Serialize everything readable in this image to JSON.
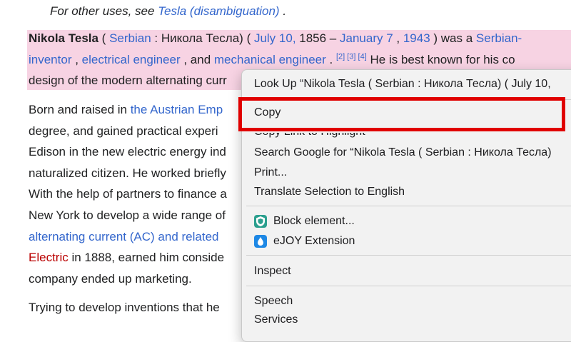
{
  "article": {
    "hatnote": {
      "prefix": "For other uses, see ",
      "link": "Tesla (disambiguation)",
      "suffix": " ."
    },
    "p1": {
      "line1": {
        "name": "Nikola Tesla",
        "t1": " ( ",
        "serbian": "Serbian",
        "t2": " : Никола Тесла) ( ",
        "date1": "July 10,",
        "t3": " 1856 – ",
        "date2": "January 7",
        "t4": " , ",
        "year2": "1943",
        "t5": " ) was a ",
        "serbian2": "Serbian-"
      },
      "line2": {
        "inventor": "inventor",
        "c1": " , ",
        "ee": "electrical engineer",
        "c2": " , and ",
        "me": "mechanical engineer",
        "c3": " . ",
        "refs": "[2] [3] [4]",
        "rest": " He is best known for his co"
      },
      "line3": "design of the modern alternating curr"
    },
    "p2": {
      "line1": {
        "text": "Born and raised in ",
        "link": "the Austrian Emp"
      },
      "line2": "degree, and gained practical experi",
      "line3": "Edison in the new electric energy ind",
      "line4": "naturalized citizen. He worked briefly",
      "line5": "With the help of partners to finance a",
      "line6": "New York to develop a wide range of",
      "line7": "alternating current (AC) and related",
      "line8": {
        "link": "Electric",
        "text": " in 1888, earned him conside"
      },
      "line9": "company ended up marketing."
    },
    "p3": {
      "line1": "Trying to develop inventions that he"
    }
  },
  "context_menu": {
    "lookup": "Look Up “Nikola Tesla ( Serbian : Никола Тесла) ( July 10,",
    "copy": "Copy",
    "copy_link": "Copy Link to Highlight",
    "search_google": "Search Google for “Nikola Tesla ( Serbian : Никола Тесла)",
    "print": "Print...",
    "translate": "Translate Selection to English",
    "block": "Block element...",
    "ejoy": "eJOY Extension",
    "inspect": "Inspect",
    "speech": "Speech",
    "services": "Services"
  },
  "colors": {
    "highlight_box": "#e00000",
    "selection": "#f7d3e3",
    "link": "#3366cc"
  }
}
